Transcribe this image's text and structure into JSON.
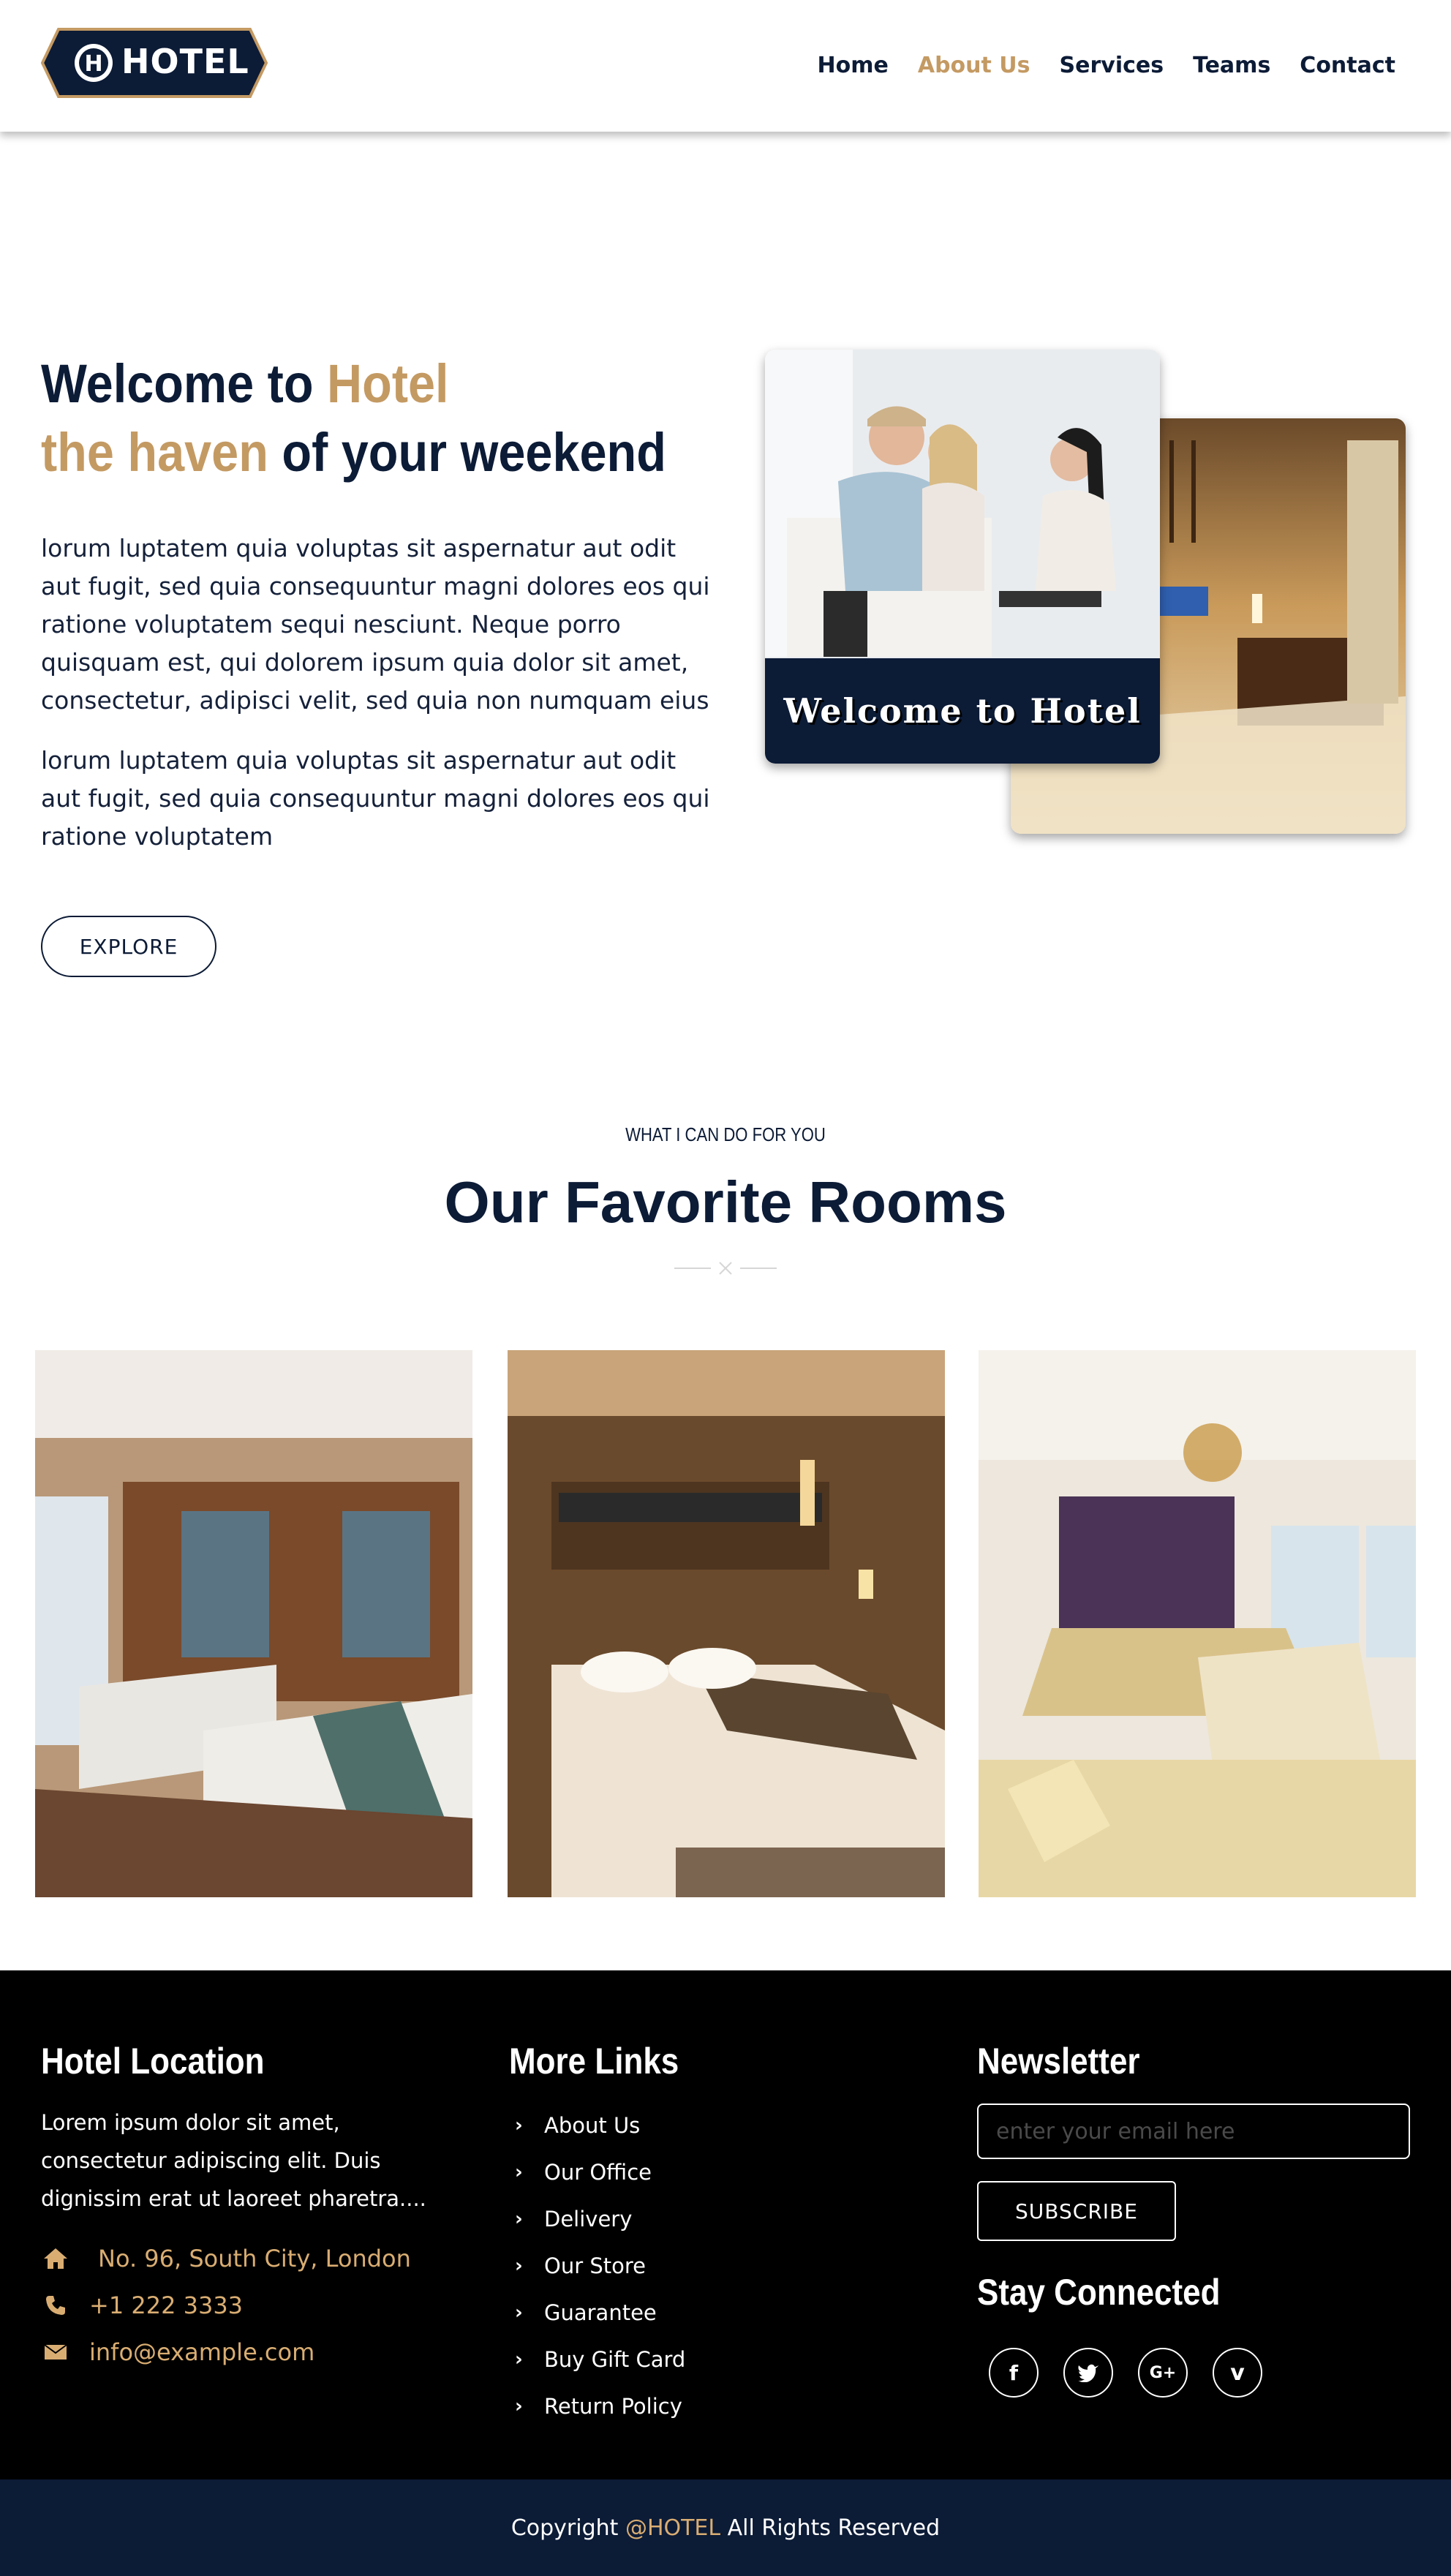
{
  "brand": {
    "logo_text": "HOTEL",
    "accent": "#c49a63",
    "navy": "#0c1b36"
  },
  "nav": {
    "items": [
      {
        "label": "Home"
      },
      {
        "label": "About Us"
      },
      {
        "label": "Services"
      },
      {
        "label": "Teams"
      },
      {
        "label": "Contact"
      }
    ],
    "active_index": 1
  },
  "hero": {
    "title_part1": "Welcome to ",
    "title_gold1": "Hotel",
    "title_gold2": "the haven",
    "title_part2": " of your weekend",
    "paragraph1": "lorum luptatem quia voluptas sit aspernatur aut odit aut fugit, sed quia consequuntur magni dolores eos qui ratione voluptatem sequi nesciunt. Neque porro quisquam est, qui dolorem ipsum quia dolor sit amet, consectetur, adipisci velit, sed quia non numquam eius",
    "paragraph2": "lorum luptatem quia voluptas sit aspernatur aut odit aut fugit, sed quia consequuntur magni dolores eos qui ratione voluptatem",
    "explore_label": "EXPLORE",
    "image_caption": "Welcome to Hotel"
  },
  "rooms": {
    "subtitle": "WHAT I CAN DO FOR YOU",
    "title": "Our Favorite Rooms"
  },
  "footer": {
    "location": {
      "heading": "Hotel Location",
      "description": "Lorem ipsum dolor sit amet, consectetur adipiscing elit. Duis dignissim erat ut laoreet pharetra....",
      "address": "No. 96, South City, London",
      "phone": "+1 222 3333",
      "email": "info@example.com"
    },
    "links": {
      "heading": "More Links",
      "items": [
        "About Us",
        "Our Office",
        "Delivery",
        "Our Store",
        "Guarantee",
        "Buy Gift Card",
        "Return Policy"
      ]
    },
    "newsletter": {
      "heading": "Newsletter",
      "placeholder": "enter your email here",
      "subscribe_label": "SUBSCRIBE",
      "stay_connected": "Stay Connected",
      "socials": [
        "facebook-icon",
        "twitter-icon",
        "google-plus-icon",
        "vimeo-icon"
      ]
    }
  },
  "copyright": {
    "prefix": "Copyright ",
    "brand": "@HOTEL",
    "suffix": " All Rights Reserved"
  }
}
